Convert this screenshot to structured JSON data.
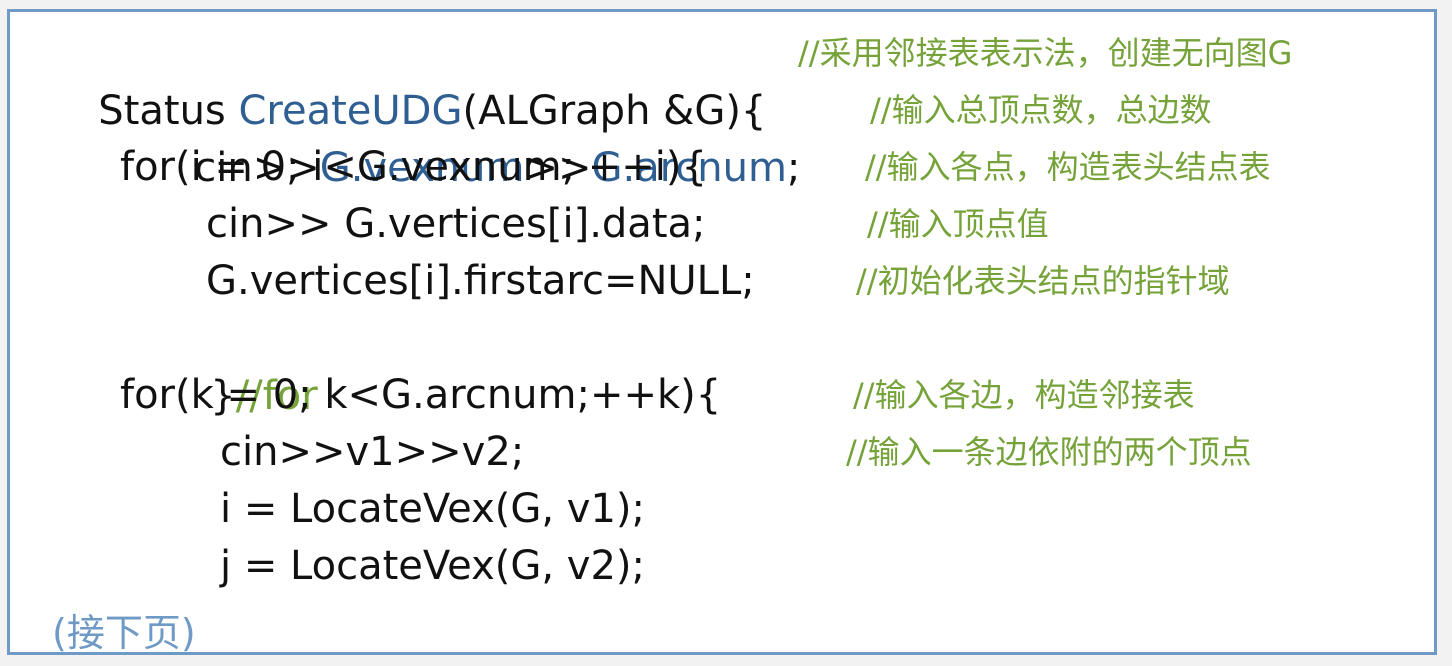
{
  "code": {
    "line1": {
      "p1": "Status ",
      "p2": "CreateUDG",
      "p3": "(ALGraph &G){",
      "comment": "//采用邻接表表示法，创建无向图G"
    },
    "line2": {
      "p1": "cin>>",
      "p2": "G.vexnum",
      "p3": ">>",
      "p4": "G.arcnum",
      "p5": ";",
      "comment": "//输入总顶点数，总边数"
    },
    "line3": {
      "text": "for(i = 0; i<G.vexnum; ++i){",
      "comment": "//输入各点，构造表头结点表"
    },
    "line4": {
      "text": "cin>> G.vertices[i].data;",
      "comment": "//输入顶点值"
    },
    "line5": {
      "text": "G.vertices[i].firstarc=NULL;",
      "comment": "//初始化表头结点的指针域"
    },
    "line6": {
      "p1": "}",
      "p2": "//for"
    },
    "line7": {
      "text": "for(k = 0; k<G.arcnum;++k){",
      "comment": "//输入各边，构造邻接表"
    },
    "line8": {
      "text": "cin>>v1>>v2;",
      "comment": "//输入一条边依附的两个顶点"
    },
    "line9": {
      "text": "i = LocateVex(G, v1);"
    },
    "line10": {
      "text": "j = LocateVex(G, v2);"
    }
  },
  "footer": {
    "next_page": "(接下页)"
  },
  "colors": {
    "frame": "#6f9ac6",
    "comment": "#76a23a",
    "function": "#2f5f92",
    "text": "#111111"
  }
}
